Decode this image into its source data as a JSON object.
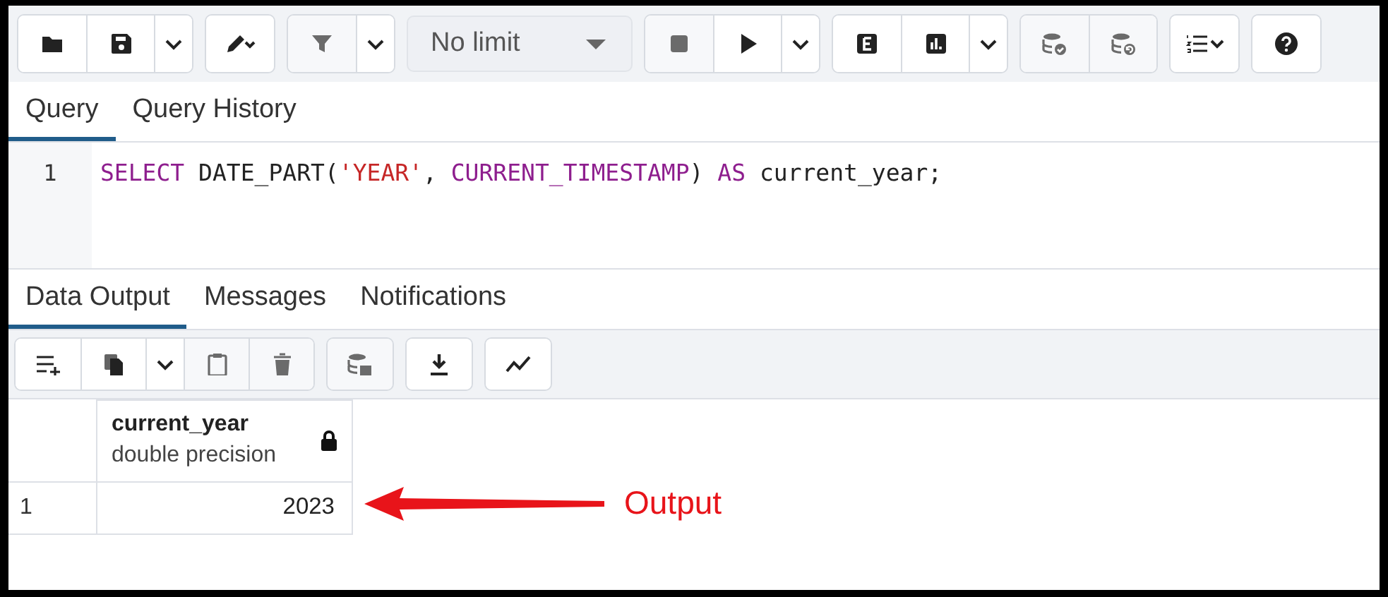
{
  "toolbar": {
    "groups": [
      {
        "kind": "buttons",
        "buttons": [
          {
            "disabled": false
          },
          {
            "disabled": false
          },
          {
            "disabled": false
          }
        ]
      },
      {
        "kind": "buttons",
        "buttons": [
          {
            "disabled": false
          }
        ]
      },
      {
        "kind": "buttons",
        "buttons": [
          {
            "disabled": true
          },
          {
            "disabled": false
          }
        ]
      },
      {
        "kind": "select",
        "value": "No limit"
      },
      {
        "kind": "buttons",
        "buttons": [
          {
            "disabled": true
          },
          {
            "disabled": false
          },
          {
            "disabled": false
          }
        ]
      },
      {
        "kind": "buttons",
        "buttons": [
          {
            "disabled": false
          },
          {
            "disabled": false
          },
          {
            "disabled": false
          }
        ]
      },
      {
        "kind": "buttons",
        "buttons": [
          {
            "disabled": true
          },
          {
            "disabled": true
          }
        ]
      },
      {
        "kind": "buttons",
        "buttons": [
          {
            "disabled": false
          }
        ]
      },
      {
        "kind": "buttons",
        "buttons": [
          {
            "disabled": false
          }
        ]
      }
    ]
  },
  "editor_tabs": [
    {
      "label": "Query",
      "selected": true
    },
    {
      "label": "Query History",
      "selected": false
    }
  ],
  "editor": {
    "lines": [
      {
        "number": "1",
        "tokens": [
          {
            "kind": "keyword",
            "text": "SELECT"
          },
          {
            "kind": "plain",
            "text": " DATE_PART("
          },
          {
            "kind": "string",
            "text": "'YEAR'"
          },
          {
            "kind": "plain",
            "text": ", "
          },
          {
            "kind": "keyword",
            "text": "CURRENT_TIMESTAMP"
          },
          {
            "kind": "plain",
            "text": ") "
          },
          {
            "kind": "keyword",
            "text": "AS"
          },
          {
            "kind": "plain",
            "text": " current_year;"
          }
        ]
      }
    ]
  },
  "output_tabs": [
    {
      "label": "Data Output",
      "selected": true
    },
    {
      "label": "Messages",
      "selected": false
    },
    {
      "label": "Notifications",
      "selected": false
    }
  ],
  "output_toolbar": {
    "groups": [
      {
        "buttons": [
          {
            "disabled": false
          },
          {
            "disabled": false
          },
          {
            "disabled": false
          },
          {
            "disabled": true
          },
          {
            "disabled": true
          }
        ]
      },
      {
        "buttons": [
          {
            "disabled": true
          }
        ]
      },
      {
        "buttons": [
          {
            "disabled": false
          }
        ]
      },
      {
        "buttons": [
          {
            "disabled": false
          }
        ]
      }
    ]
  },
  "table": {
    "columns": [
      {
        "name": "current_year",
        "type": "double precision",
        "locked": true
      }
    ],
    "rows": [
      {
        "number": "1",
        "cells": [
          "2023"
        ]
      }
    ]
  },
  "annotation": {
    "text": "Output"
  }
}
